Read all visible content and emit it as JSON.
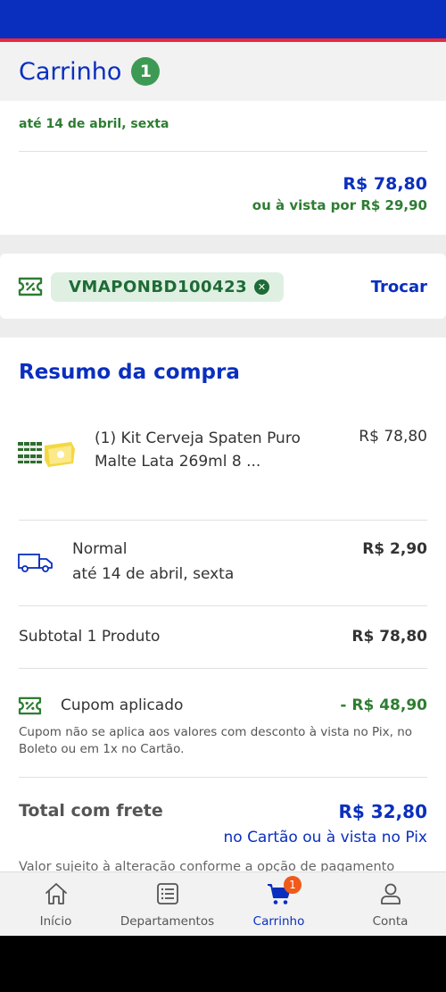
{
  "header": {
    "title": "Carrinho",
    "count": "1"
  },
  "delivery": {
    "date": "até 14 de abril, sexta",
    "price": "R$ 78,80",
    "pix_price": "ou à vista por R$ 29,90"
  },
  "coupon": {
    "code": "VMAPONBD100423",
    "remove_icon": "close-icon",
    "change_label": "Trocar"
  },
  "summary": {
    "heading": "Resumo da compra",
    "product": {
      "name": "(1) Kit Cerveja Spaten Puro Malte Lata 269ml 8 ...",
      "price": "R$ 78,80"
    },
    "shipping": {
      "type": "Normal",
      "date": "até 14 de abril, sexta",
      "price": "R$ 2,90"
    },
    "subtotal": {
      "label": "Subtotal 1 Produto",
      "value": "R$ 78,80"
    },
    "coupon_applied": {
      "label": "Cupom aplicado",
      "value": "- R$ 48,90",
      "note": "Cupom não se aplica aos valores com desconto à vista no Pix, no Boleto ou em 1x no Cartão."
    },
    "total": {
      "label": "Total com frete",
      "value": "R$ 32,80",
      "sub": "no Cartão ou à vista no Pix",
      "disclaimer": "Valor sujeito à alteração conforme a opção de pagamento"
    }
  },
  "nav": {
    "items": [
      {
        "label": "Início",
        "icon": "home-icon"
      },
      {
        "label": "Departamentos",
        "icon": "list-icon"
      },
      {
        "label": "Carrinho",
        "icon": "cart-icon",
        "badge": "1"
      },
      {
        "label": "Conta",
        "icon": "user-icon"
      }
    ]
  },
  "colors": {
    "primary": "#0a2fbf",
    "green": "#2e7d32",
    "badge_orange": "#f05a1a",
    "accent_red": "#e8293e"
  }
}
